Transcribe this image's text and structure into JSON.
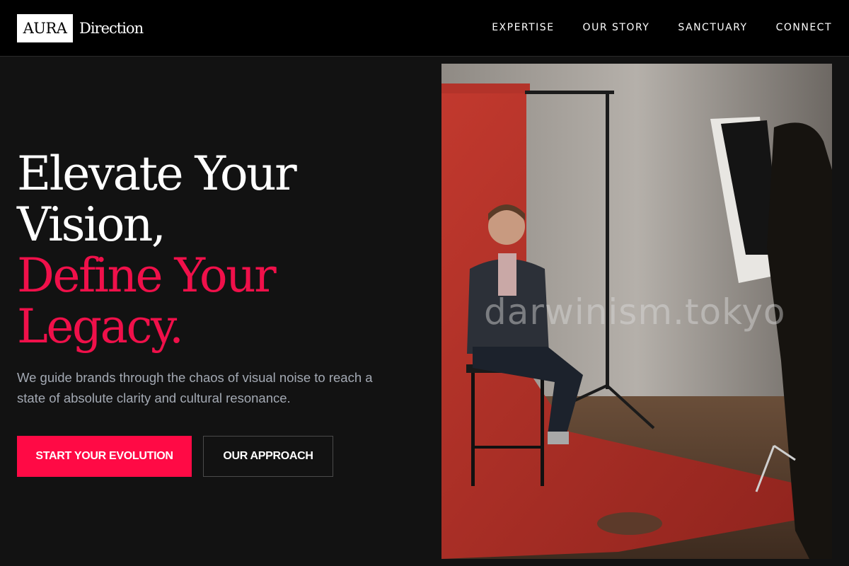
{
  "brand": {
    "box_text": "AURA",
    "word": "Direction"
  },
  "nav": {
    "items": [
      {
        "label": "EXPERTISE"
      },
      {
        "label": "OUR STORY"
      },
      {
        "label": "SANCTUARY"
      },
      {
        "label": "CONNECT"
      }
    ]
  },
  "hero": {
    "headline_lines": [
      "Elevate Your",
      "Vision,"
    ],
    "accent_lines": [
      "Define Your",
      "Legacy."
    ],
    "subtext": "We guide brands through the chaos of visual noise to reach a state of absolute clarity and cultural resonance.",
    "primary_cta": "START YOUR EVOLUTION",
    "secondary_cta": "OUR APPROACH"
  },
  "photo": {
    "watermark": "darwinism.tokyo"
  },
  "colors": {
    "accent": "#ff0a45",
    "headline_accent": "#f0104a",
    "background": "#121212",
    "header": "#000000",
    "subtext": "#a3a9b3"
  }
}
